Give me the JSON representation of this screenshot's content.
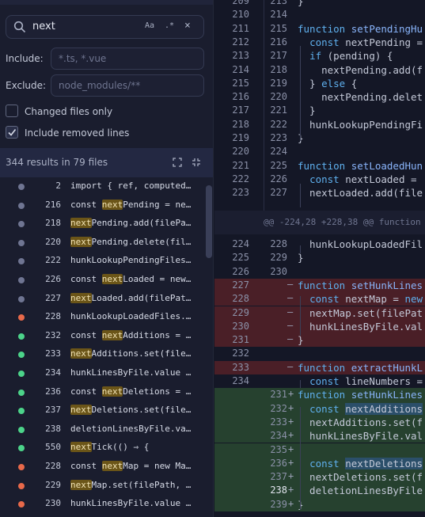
{
  "search": {
    "query": "next",
    "match_case_label": "Aa",
    "regex_label": ".*",
    "clear_label": "×",
    "include_label": "Include:",
    "include_placeholder": "*.ts, *.vue",
    "exclude_label": "Exclude:",
    "exclude_placeholder": "node_modules/**",
    "changed_only_label": "Changed files only",
    "changed_only_checked": false,
    "include_removed_label": "Include removed lines",
    "include_removed_checked": true,
    "summary": "344 results in 79 files"
  },
  "results": [
    {
      "status": "n",
      "line": "2",
      "pre": "import { ref, computed",
      "match": "",
      "post": "…"
    },
    {
      "status": "n",
      "line": "216",
      "pre": "const ",
      "match": "next",
      "post": "Pending = ne…"
    },
    {
      "status": "n",
      "line": "218",
      "pre": "",
      "match": "next",
      "post": "Pending.add(filePa…"
    },
    {
      "status": "n",
      "line": "220",
      "pre": "",
      "match": "next",
      "post": "Pending.delete(fil…"
    },
    {
      "status": "n",
      "line": "222",
      "pre": "hunkLookupPendingFiles…",
      "match": "",
      "post": ""
    },
    {
      "status": "n",
      "line": "226",
      "pre": "const ",
      "match": "next",
      "post": "Loaded = new…"
    },
    {
      "status": "n",
      "line": "227",
      "pre": "",
      "match": "next",
      "post": "Loaded.add(filePat…"
    },
    {
      "status": "r",
      "line": "228",
      "pre": "hunkLookupLoadedFiles.…",
      "match": "",
      "post": ""
    },
    {
      "status": "g",
      "line": "232",
      "pre": "const ",
      "match": "next",
      "post": "Additions = …"
    },
    {
      "status": "g",
      "line": "233",
      "pre": "",
      "match": "next",
      "post": "Additions.set(file…"
    },
    {
      "status": "g",
      "line": "234",
      "pre": "hunkLinesByFile.value …",
      "match": "",
      "post": ""
    },
    {
      "status": "g",
      "line": "236",
      "pre": "const ",
      "match": "next",
      "post": "Deletions = …"
    },
    {
      "status": "g",
      "line": "237",
      "pre": "",
      "match": "next",
      "post": "Deletions.set(file…"
    },
    {
      "status": "g",
      "line": "238",
      "pre": "deletionLinesByFile.va…",
      "match": "",
      "post": ""
    },
    {
      "status": "g",
      "line": "550",
      "pre": "",
      "match": "next",
      "post": "Tick(() ⇒ {"
    },
    {
      "status": "r",
      "line": "228",
      "pre": "const ",
      "match": "next",
      "post": "Map = new Ma…"
    },
    {
      "status": "r",
      "line": "229",
      "pre": "",
      "match": "next",
      "post": "Map.set(filePath, …"
    },
    {
      "status": "r",
      "line": "230",
      "pre": "hunkLinesByFile.value …",
      "match": "",
      "post": ""
    }
  ],
  "editor": {
    "hunk_header": "@@ -224,28 +228,38 @@ function",
    "lines": [
      {
        "l": "209",
        "r": "213",
        "code": "}",
        "type": "ctx"
      },
      {
        "l": "210",
        "r": "214",
        "code": "",
        "type": "ctx"
      },
      {
        "l": "211",
        "r": "215",
        "code": "function setPendingHu",
        "type": "ctx"
      },
      {
        "l": "212",
        "r": "216",
        "code": "  const nextPending =",
        "type": "ctx"
      },
      {
        "l": "213",
        "r": "217",
        "code": "  if (pending) {",
        "type": "ctx"
      },
      {
        "l": "214",
        "r": "218",
        "code": "    nextPending.add(f",
        "type": "ctx"
      },
      {
        "l": "215",
        "r": "219",
        "code": "  } else {",
        "type": "ctx"
      },
      {
        "l": "216",
        "r": "220",
        "code": "    nextPending.delet",
        "type": "ctx"
      },
      {
        "l": "217",
        "r": "221",
        "code": "  }",
        "type": "ctx"
      },
      {
        "l": "218",
        "r": "222",
        "code": "  hunkLookupPendingFi",
        "type": "ctx"
      },
      {
        "l": "219",
        "r": "223",
        "code": "}",
        "type": "ctx"
      },
      {
        "l": "220",
        "r": "224",
        "code": "",
        "type": "ctx"
      },
      {
        "l": "221",
        "r": "225",
        "code": "function setLoadedHun",
        "type": "ctx"
      },
      {
        "l": "222",
        "r": "226",
        "code": "  const nextLoaded =",
        "type": "ctx"
      },
      {
        "l": "223",
        "r": "227",
        "code": "  nextLoaded.add(file",
        "type": "ctx"
      }
    ],
    "lines2": [
      {
        "l": "224",
        "r": "228",
        "code": "  hunkLookupLoadedFil",
        "type": "ctx"
      },
      {
        "l": "225",
        "r": "229",
        "code": "}",
        "type": "ctx"
      },
      {
        "l": "226",
        "r": "230",
        "code": "",
        "type": "ctx"
      },
      {
        "l": "227",
        "r": "",
        "code": "function setHunkLines",
        "type": "del"
      },
      {
        "l": "228",
        "r": "",
        "code": "  const nextMap = new",
        "type": "del"
      },
      {
        "l": "229",
        "r": "",
        "code": "  nextMap.set(filePat",
        "type": "del"
      },
      {
        "l": "230",
        "r": "",
        "code": "  hunkLinesByFile.val",
        "type": "del"
      },
      {
        "l": "231",
        "r": "",
        "code": "}",
        "type": "del"
      },
      {
        "l": "232",
        "r": "",
        "code": "",
        "type": "ctx"
      },
      {
        "l": "233",
        "r": "",
        "code": "function extractHunkL",
        "type": "del"
      },
      {
        "l": "234",
        "r": "",
        "code": "  const lineNumbers =",
        "type": "ctx"
      },
      {
        "l": "",
        "r": "231",
        "code": "function setHunkLines",
        "type": "add"
      },
      {
        "l": "",
        "r": "232",
        "code": "  const nextAdditions",
        "type": "mod"
      },
      {
        "l": "",
        "r": "233",
        "code": "  nextAdditions.set(f",
        "type": "add"
      },
      {
        "l": "",
        "r": "234",
        "code": "  hunkLinesByFile.val",
        "type": "add"
      },
      {
        "l": "",
        "r": "235",
        "code": "",
        "type": "add"
      },
      {
        "l": "",
        "r": "236",
        "code": "  const nextDeletions",
        "type": "mod"
      },
      {
        "l": "",
        "r": "237",
        "code": "  nextDeletions.set(f",
        "type": "add"
      },
      {
        "l": "",
        "r": "238",
        "code": "  deletionLinesByFile",
        "type": "add"
      },
      {
        "l": "",
        "r": "239",
        "code": "}",
        "type": "add"
      }
    ]
  },
  "colors": {
    "added": "#4cd48a",
    "removed": "#e8694a",
    "match_highlight": "#6b5518",
    "accent": "#5fb0ee"
  }
}
